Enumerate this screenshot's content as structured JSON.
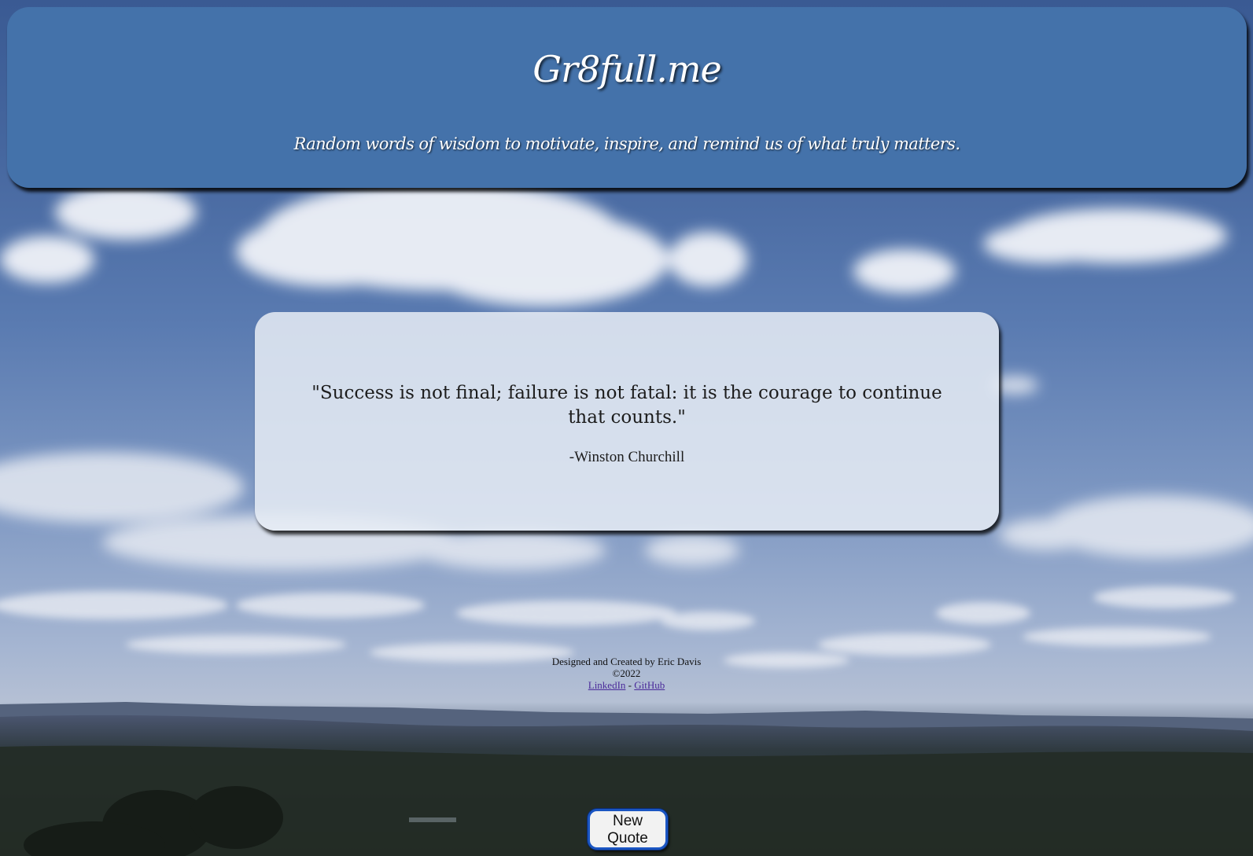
{
  "header": {
    "title": "Gr8full.me",
    "tagline": "Random words of wisdom to motivate, inspire, and remind us of what truly matters."
  },
  "quote": {
    "text": "\"Success is not final; failure is not fatal: it is the courage to continue that counts.\"",
    "author": "-Winston Churchill"
  },
  "footer": {
    "credit": "Designed and Created by Eric Davis",
    "copyright": "©2022",
    "linkedin_label": "LinkedIn",
    "separator": "-",
    "github_label": "GitHub"
  },
  "button": {
    "new_quote_label": "New Quote"
  },
  "colors": {
    "header_bg": "#4472aa",
    "card_bg": "#e7ecf4",
    "button_border": "#1a55c2",
    "link": "#4a2a9a"
  }
}
